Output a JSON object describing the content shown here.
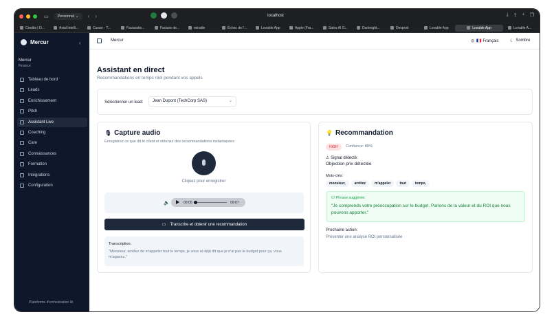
{
  "browser": {
    "profile": "Personnel",
    "url": "localhost",
    "tabs": [
      "Credits | O...",
      "Axial Intelli...",
      "Cursor - T...",
      "Facturatio...",
      "Facture de...",
      "miradie",
      "Échec de l'...",
      "Lovable App",
      "Apple (Fra...",
      "Sales AI G...",
      "Darknight...",
      "Devpost",
      "Lovable App",
      "Lovable App",
      "Lovable A..."
    ],
    "active_tab_index": 13
  },
  "sidebar": {
    "brand": "Mercur",
    "org_name": "Mercur",
    "org_sub": "Finance",
    "items": [
      {
        "label": "Tableau de bord",
        "icon": "dashboard-icon"
      },
      {
        "label": "Leads",
        "icon": "users-icon"
      },
      {
        "label": "Enrichissement",
        "icon": "search-icon"
      },
      {
        "label": "Pitch",
        "icon": "phone-icon"
      },
      {
        "label": "Assistant Live",
        "icon": "mic-icon"
      },
      {
        "label": "Coaching",
        "icon": "chart-icon"
      },
      {
        "label": "Care",
        "icon": "heart-icon"
      },
      {
        "label": "Connaissances",
        "icon": "database-icon"
      },
      {
        "label": "Formation",
        "icon": "graduation-icon"
      },
      {
        "label": "Intégrations",
        "icon": "plug-icon"
      },
      {
        "label": "Configuration",
        "icon": "gear-icon"
      }
    ],
    "active_index": 4,
    "footer": "Plateforme d'orchestration IA"
  },
  "topbar": {
    "breadcrumb": "Mercur",
    "language": "🇫🇷 Français",
    "theme": "Sombre"
  },
  "page": {
    "title": "Assistant en direct",
    "subtitle": "Recommandations en temps réel pendant vos appels"
  },
  "lead_select": {
    "label": "Sélectionner un lead:",
    "value": "Jean Dupont (TechCorp SAS)"
  },
  "capture": {
    "title": "Capture audio",
    "subtitle": "Enregistrez ce que dit le client et obtenez des recommandations instantanées",
    "record_hint": "Cliquez pour enregistrer",
    "time_current": "00:00",
    "time_total": "00:07",
    "cta": "Transcrire et obtenir une recommandation",
    "transcription_label": "Transcription:",
    "transcription": "\"Monsieur, arrêtez de m'appeler tout le temps, je vous ai déjà dit que je n'ai pas le budget pour ça, vous m'agacez.\""
  },
  "recommendation": {
    "title": "Recommandation",
    "priority": "HIGH",
    "confidence": "Confiance: 88%",
    "signal_label": "Signal détecté:",
    "signal_value": "Objection prix détectée",
    "keywords_label": "Mots-clés:",
    "keywords": [
      "monsieur,",
      "arrêtez",
      "m'appeler",
      "tout",
      "temps,"
    ],
    "suggested_label": "Phrase suggérée:",
    "suggested_text": "\"Je comprends votre préoccupation sur le budget. Parlons de la valeur et du ROI que nous pouvons apporter.\"",
    "next_label": "Prochaine action:",
    "next_value": "Présenter une analyse ROI personnalisée"
  }
}
